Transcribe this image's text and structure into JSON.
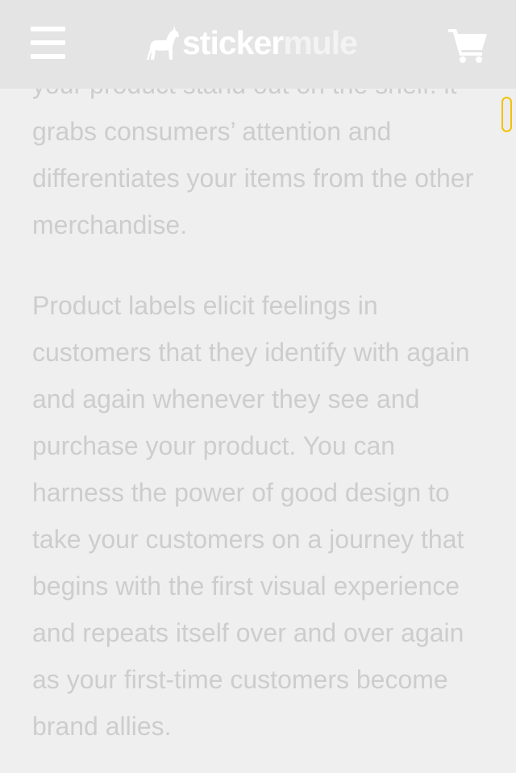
{
  "header": {
    "menu_icon": "hamburger-menu-icon",
    "logo": {
      "icon": "mule-icon",
      "text_part1": "sticker",
      "text_part2": "mule"
    },
    "cart_icon": "shopping-cart-icon"
  },
  "article": {
    "paragraphs": [
      "your product stand out on the shelf: it grabs consumers’ attention and differentiates your items from the other merchandise.",
      "Product labels elicit feelings in customers that they identify with again and again whenever they see and purchase your product. You can harness the power of good design to take your customers on a journey that begins with the first visual experience and repeats itself over and over again as your first-time customers become brand allies."
    ]
  },
  "colors": {
    "header_bg": "#e4e4e4",
    "page_bg": "#efefef",
    "text": "#cdcdcd",
    "scroll_indicator": "#f2c200"
  }
}
